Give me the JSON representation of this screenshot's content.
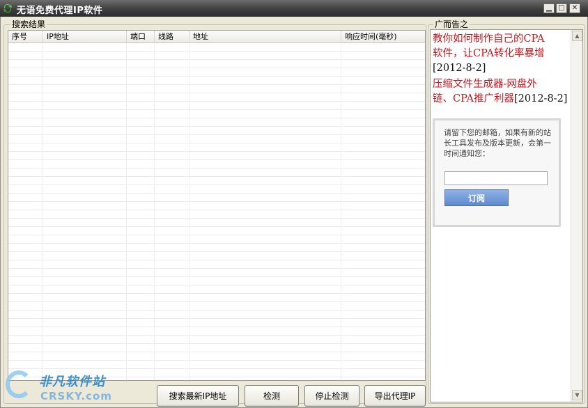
{
  "window": {
    "title": "无语免费代理IP软件",
    "min_glyph": "▁",
    "max_glyph": "□",
    "close_glyph": "✕"
  },
  "results": {
    "group_label": "搜索结果",
    "columns": [
      "序号",
      "IP地址",
      "端口",
      "线路",
      "地址",
      "响应时间(毫秒)"
    ],
    "rows": []
  },
  "buttons": {
    "search": "搜索最新IP地址",
    "check": "检测",
    "stop": "停止检测",
    "export": "导出代理IP"
  },
  "ad": {
    "group_label": "广而告之",
    "news": [
      {
        "lines": [
          "教你如何制作自己的CPA",
          "软件，让CPA转化率暴增"
        ],
        "date": "[2012-8-2]"
      },
      {
        "lines": [
          "压缩文件生成器-网盘外",
          "链、CPA推广利器"
        ],
        "date": "[2012-8-2]"
      }
    ],
    "subscribe": {
      "text": "请留下您的邮箱，如果有新的站长工具发布及版本更新，会第一时间通知您：",
      "email_value": "",
      "button": "订阅"
    }
  },
  "watermark": {
    "cn": "非凡软件站",
    "en": "CRSKY.com"
  },
  "colors": {
    "news_link": "#c8161d",
    "subscribe_button": "#6b95d6",
    "title_bar": "#3e3e3e"
  },
  "icons": [
    "app-logo-icon",
    "minimize-icon",
    "maximize-icon",
    "close-icon",
    "scroll-up-icon",
    "scroll-down-icon"
  ]
}
